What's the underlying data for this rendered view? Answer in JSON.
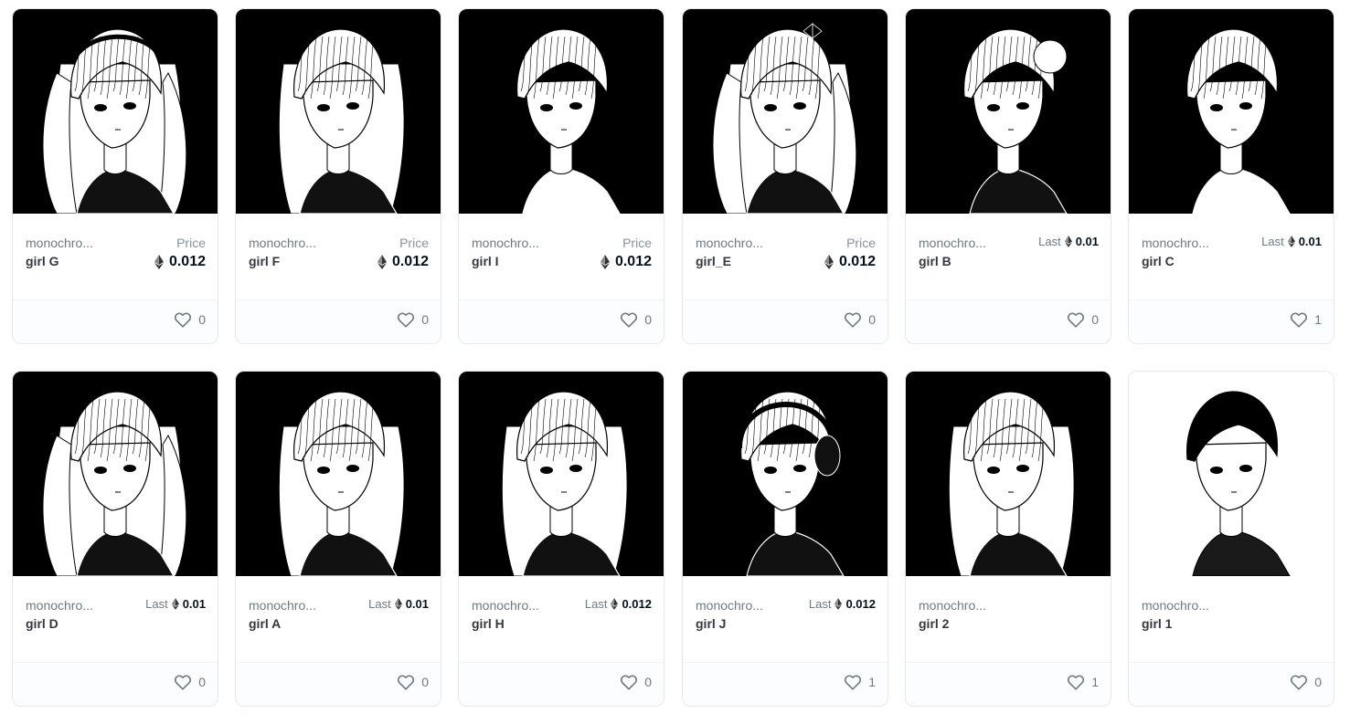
{
  "cards": [
    {
      "collection": "monochro...",
      "name": "girl G",
      "kind": "price",
      "price_label": "Price",
      "price": "0.012",
      "favorites": "0",
      "art": {
        "bg": "#000000",
        "hair": "long-twintails-headband"
      }
    },
    {
      "collection": "monochro...",
      "name": "girl F",
      "kind": "price",
      "price_label": "Price",
      "price": "0.012",
      "favorites": "0",
      "art": {
        "bg": "#000000",
        "hair": "long-straight-bangs-choker"
      }
    },
    {
      "collection": "monochro...",
      "name": "girl I",
      "kind": "price",
      "price_label": "Price",
      "price": "0.012",
      "favorites": "0",
      "art": {
        "bg": "#000000",
        "hair": "bob-hoodie"
      }
    },
    {
      "collection": "monochro...",
      "name": "girl_E",
      "kind": "price",
      "price_label": "Price",
      "price": "0.012",
      "favorites": "0",
      "art": {
        "bg": "#000000",
        "hair": "wavy-twintails-bow"
      }
    },
    {
      "collection": "monochro...",
      "name": "girl B",
      "kind": "last",
      "price_label": "Last",
      "price": "0.01",
      "favorites": "0",
      "art": {
        "bg": "#000000",
        "hair": "bun"
      }
    },
    {
      "collection": "monochro...",
      "name": "girl C",
      "kind": "last",
      "price_label": "Last",
      "price": "0.01",
      "favorites": "1",
      "art": {
        "bg": "#000000",
        "hair": "short-hoodie"
      }
    },
    {
      "collection": "monochro...",
      "name": "girl D",
      "kind": "last",
      "price_label": "Last",
      "price": "0.01",
      "favorites": "0",
      "art": {
        "bg": "#000000",
        "hair": "twintails-sailor"
      }
    },
    {
      "collection": "monochro...",
      "name": "girl A",
      "kind": "last",
      "price_label": "Last",
      "price": "0.01",
      "favorites": "0",
      "art": {
        "bg": "#000000",
        "hair": "long-straight"
      }
    },
    {
      "collection": "monochro...",
      "name": "girl H",
      "kind": "last",
      "price_label": "Last",
      "price": "0.012",
      "favorites": "0",
      "art": {
        "bg": "#000000",
        "hair": "long-straight-earring"
      }
    },
    {
      "collection": "monochro...",
      "name": "girl J",
      "kind": "last",
      "price_label": "Last",
      "price": "0.012",
      "favorites": "1",
      "art": {
        "bg": "#000000",
        "hair": "short-headphones"
      }
    },
    {
      "collection": "monochro...",
      "name": "girl 2",
      "kind": "none",
      "price_label": "",
      "price": "",
      "favorites": "1",
      "art": {
        "bg": "#000000",
        "hair": "long-wavy"
      }
    },
    {
      "collection": "monochro...",
      "name": "girl 1",
      "kind": "none",
      "price_label": "",
      "price": "",
      "favorites": "0",
      "art": {
        "bg": "#ffffff",
        "hair": "short-black"
      }
    }
  ],
  "icons": {
    "currency": "ethereum-icon",
    "favorite": "heart-outline-icon"
  },
  "colors": {
    "border": "#e5e8eb",
    "muted_text": "#707a83",
    "strong_text": "#04111d",
    "art_dark": "#000000",
    "art_light": "#ffffff"
  }
}
